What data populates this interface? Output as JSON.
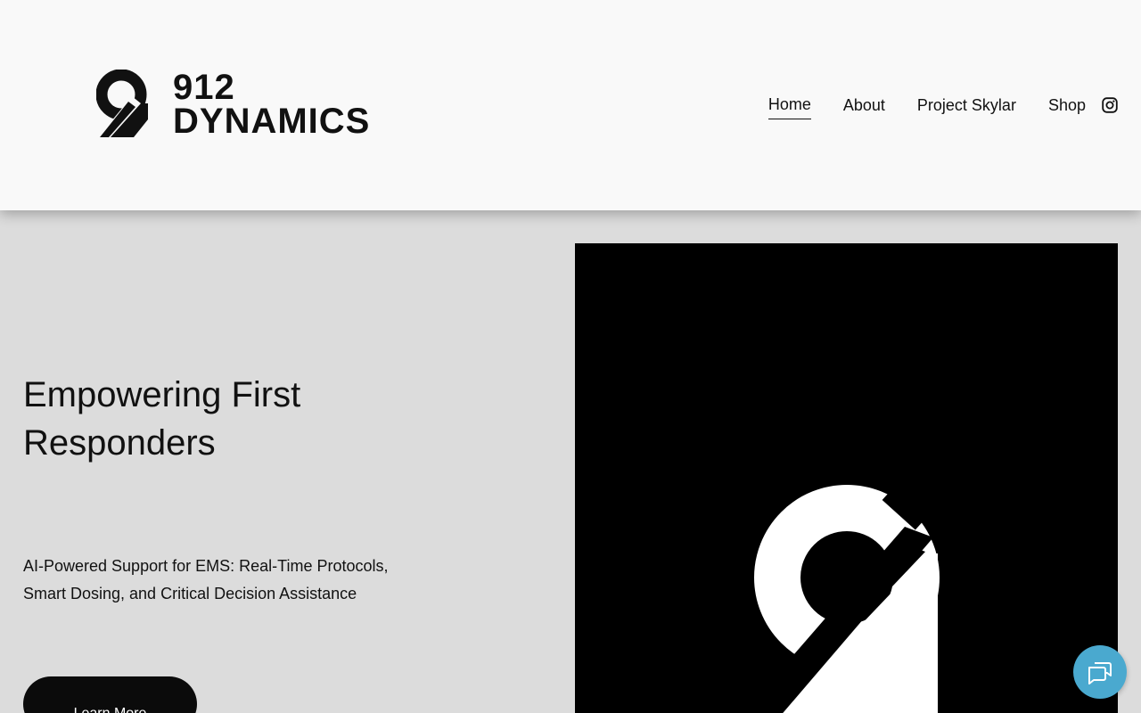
{
  "brand": {
    "logo_number": "912",
    "logo_word": "DYNAMICS",
    "colors": {
      "ink": "#111111",
      "header_bg": "#f9f9f9",
      "page_bg": "#dcdcdc",
      "chat_button": "#4aa9cf"
    }
  },
  "nav": {
    "items": [
      {
        "label": "Home",
        "active": true
      },
      {
        "label": "About"
      },
      {
        "label": "Project Skylar"
      },
      {
        "label": "Shop"
      }
    ],
    "social_icon": "instagram-icon"
  },
  "hero": {
    "title": "Empowering First Responders",
    "subtitle": "AI-Powered Support for EMS: Real-Time Protocols, Smart Dosing, and Critical Decision Assistance",
    "cta_label": "Learn More",
    "image_icon": "912-dynamics-mark"
  },
  "chat": {
    "icon": "chat-bubbles-icon"
  }
}
